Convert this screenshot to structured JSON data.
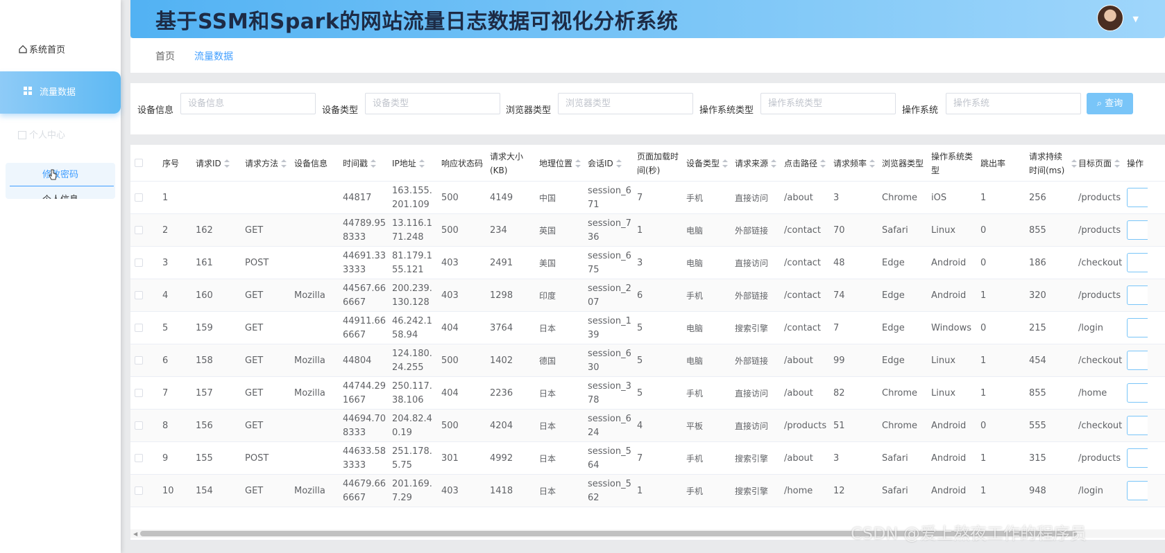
{
  "header": {
    "title": "基于SSM和Spark的网站流量日志数据可视化分析系统"
  },
  "sidebar": {
    "home": "系统首页",
    "traffic": "流量数据",
    "personal": "个人中心",
    "sub_change_password": "修改密码",
    "sub_personal_info": "个人信息"
  },
  "breadcrumb": {
    "home": "首页",
    "current": "流量数据"
  },
  "search": {
    "fields": [
      {
        "label": "设备信息",
        "placeholder": "设备信息"
      },
      {
        "label": "设备类型",
        "placeholder": "设备类型"
      },
      {
        "label": "浏览器类型",
        "placeholder": "浏览器类型"
      },
      {
        "label": "操作系统类型",
        "placeholder": "操作系统类型"
      },
      {
        "label": "操作系统",
        "placeholder": "操作系统"
      }
    ],
    "button": "查询"
  },
  "table": {
    "columns": [
      "序号",
      "请求ID",
      "请求方法",
      "设备信息",
      "时间戳",
      "IP地址",
      "响应状态码",
      "请求大小(KB)",
      "地理位置",
      "会话ID",
      "页面加载时间(秒)",
      "设备类型",
      "请求来源",
      "点击路径",
      "请求频率",
      "浏览器类型",
      "操作系统类型",
      "跳出率",
      "请求持续时间(ms)",
      "目标页面",
      "操作"
    ],
    "rows": [
      [
        "1",
        "",
        "",
        "",
        "44817",
        "163.155.201.109",
        "500",
        "4149",
        "中国",
        "session_671",
        "7",
        "手机",
        "直接访问",
        "/about",
        "3",
        "Chrome",
        "iOS",
        "1",
        "256",
        "/products"
      ],
      [
        "2",
        "162",
        "GET",
        "",
        "44789.958333",
        "13.116.171.248",
        "500",
        "234",
        "英国",
        "session_736",
        "1",
        "电脑",
        "外部链接",
        "/contact",
        "70",
        "Safari",
        "Linux",
        "0",
        "855",
        "/products"
      ],
      [
        "3",
        "161",
        "POST",
        "",
        "44691.333333",
        "81.179.155.121",
        "403",
        "2491",
        "美国",
        "session_675",
        "3",
        "电脑",
        "直接访问",
        "/contact",
        "48",
        "Edge",
        "Android",
        "0",
        "186",
        "/checkout"
      ],
      [
        "4",
        "160",
        "GET",
        "Mozilla",
        "44567.666667",
        "200.239.130.128",
        "403",
        "1298",
        "印度",
        "session_207",
        "6",
        "手机",
        "外部链接",
        "/contact",
        "74",
        "Edge",
        "Android",
        "1",
        "320",
        "/products"
      ],
      [
        "5",
        "159",
        "GET",
        "",
        "44911.666667",
        "46.242.158.94",
        "404",
        "3764",
        "日本",
        "session_139",
        "5",
        "电脑",
        "搜索引擎",
        "/contact",
        "7",
        "Edge",
        "Windows",
        "0",
        "215",
        "/login"
      ],
      [
        "6",
        "158",
        "GET",
        "Mozilla",
        "44804",
        "124.180.24.255",
        "500",
        "1402",
        "德国",
        "session_630",
        "5",
        "电脑",
        "外部链接",
        "/about",
        "99",
        "Edge",
        "Linux",
        "1",
        "454",
        "/checkout"
      ],
      [
        "7",
        "157",
        "GET",
        "Mozilla",
        "44744.291667",
        "250.117.38.106",
        "404",
        "2236",
        "日本",
        "session_378",
        "5",
        "手机",
        "直接访问",
        "/about",
        "82",
        "Chrome",
        "Linux",
        "1",
        "855",
        "/home"
      ],
      [
        "8",
        "156",
        "GET",
        "",
        "44694.708333",
        "204.82.40.19",
        "500",
        "4204",
        "日本",
        "session_624",
        "4",
        "平板",
        "直接访问",
        "/products",
        "51",
        "Chrome",
        "Android",
        "0",
        "555",
        "/checkout"
      ],
      [
        "9",
        "155",
        "POST",
        "",
        "44633.583333",
        "251.178.5.75",
        "301",
        "4992",
        "日本",
        "session_564",
        "7",
        "手机",
        "搜索引擎",
        "/about",
        "3",
        "Safari",
        "Android",
        "1",
        "315",
        "/products"
      ],
      [
        "10",
        "154",
        "GET",
        "Mozilla",
        "44679.666667",
        "201.169.7.29",
        "403",
        "1418",
        "日本",
        "session_562",
        "1",
        "手机",
        "搜索引擎",
        "/home",
        "12",
        "Safari",
        "Android",
        "1",
        "948",
        "/login"
      ]
    ]
  },
  "watermark": "CSDN @爱上熬夜工作的程序员"
}
